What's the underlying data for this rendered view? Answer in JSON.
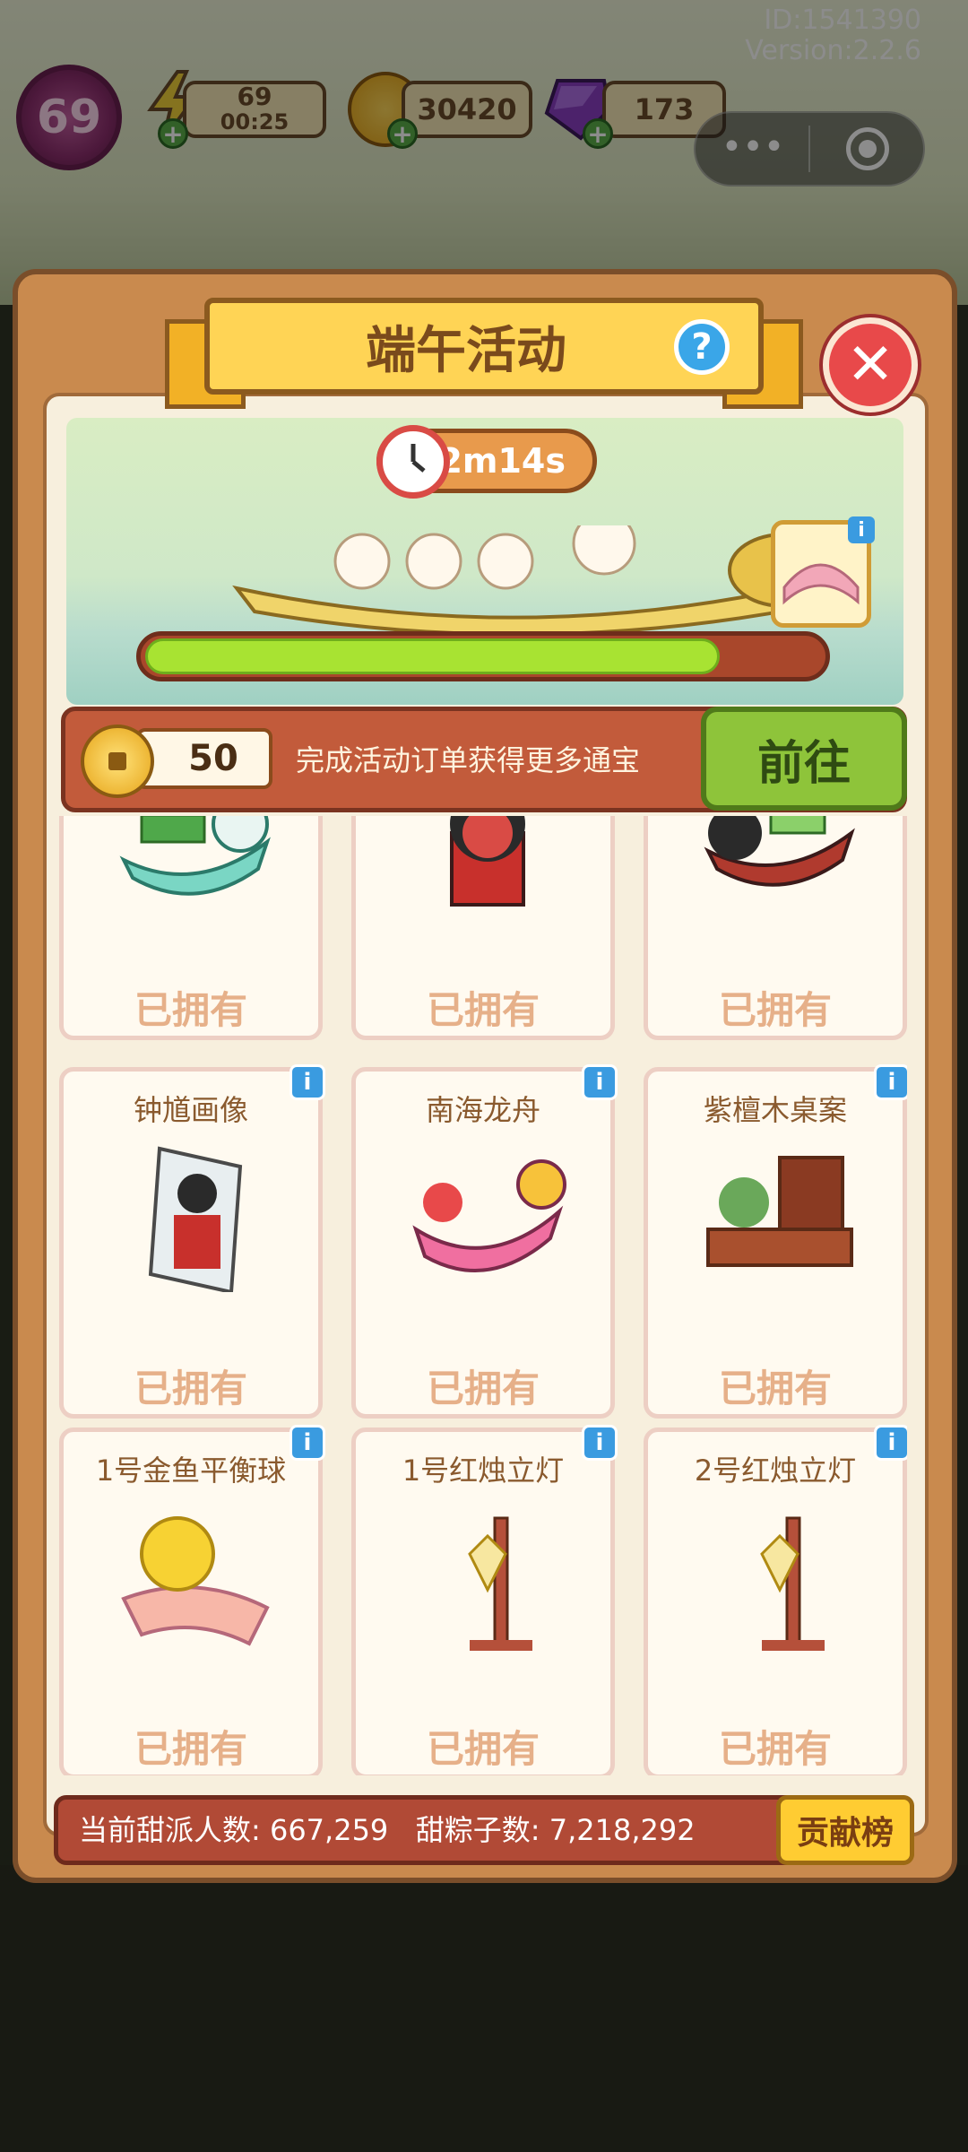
{
  "header": {
    "level": "69",
    "energy_value": "69",
    "energy_timer": "00:25",
    "coins": "30420",
    "gems": "173",
    "id_text": "ID:1541390",
    "version_text": "Version:2.2.6",
    "more_glyph": "•••"
  },
  "event": {
    "title": "端午活动",
    "help_glyph": "?",
    "close_glyph": "✕",
    "timer": "2m14s",
    "progress": 0.85,
    "info_glyph": "i"
  },
  "currency": {
    "token_count": "50",
    "hint": "完成活动订单获得更多通宝",
    "go_label": "前往"
  },
  "items": [
    {
      "name": "",
      "status": "已拥有",
      "art": "dragon-boat-teal"
    },
    {
      "name": "",
      "status": "已拥有",
      "art": "zhong-kui-figure"
    },
    {
      "name": "",
      "status": "已拥有",
      "art": "dragon-boat-black"
    },
    {
      "name": "钟馗画像",
      "status": "已拥有",
      "art": "portrait"
    },
    {
      "name": "南海龙舟",
      "status": "已拥有",
      "art": "dragon-boat-pink"
    },
    {
      "name": "紫檀木桌案",
      "status": "已拥有",
      "art": "desk"
    },
    {
      "name": "1号金鱼平衡球",
      "status": "已拥有",
      "art": "goldfish-ball"
    },
    {
      "name": "1号红烛立灯",
      "status": "已拥有",
      "art": "lamp"
    },
    {
      "name": "2号红烛立灯",
      "status": "已拥有",
      "art": "lamp"
    }
  ],
  "footer": {
    "stats": "当前甜派人数: 667,259   甜粽子数: 7,218,292",
    "contribution_label": "贡献榜"
  },
  "colors": {
    "panel": "#c98a4e",
    "progress_fill": "#a8e332",
    "go_button": "#8ec43a",
    "close_button": "#e8494a",
    "info_badge": "#3a9be0"
  }
}
